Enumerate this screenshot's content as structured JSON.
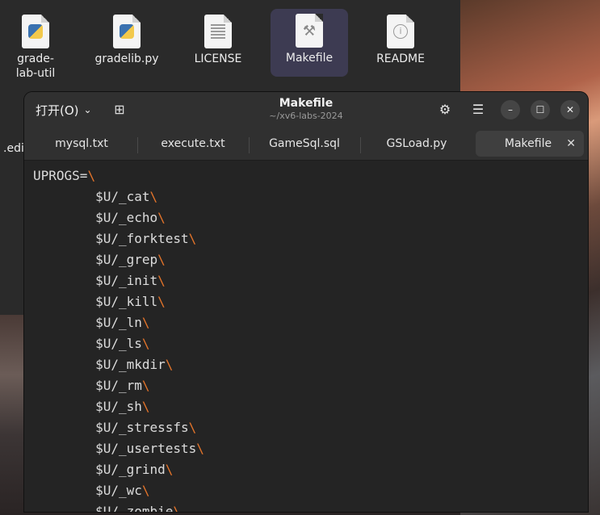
{
  "desktop": {
    "files": [
      {
        "label": "grade-lab-util",
        "icon": "python-file-icon"
      },
      {
        "label": "gradelib.py",
        "icon": "python-file-icon"
      },
      {
        "label": "LICENSE",
        "icon": "text-file-icon"
      },
      {
        "label": "Makefile",
        "icon": "makefile-icon",
        "selected": true
      },
      {
        "label": "README",
        "icon": "info-file-icon"
      }
    ],
    "peek_label": ".edi"
  },
  "window": {
    "open_label": "打开(O)",
    "title": "Makefile",
    "subtitle": "~/xv6-labs-2024",
    "tabs": [
      {
        "label": "mysql.txt"
      },
      {
        "label": "execute.txt"
      },
      {
        "label": "GameSql.sql"
      },
      {
        "label": "GSLoad.py"
      },
      {
        "label": "Makefile",
        "active": true
      }
    ],
    "code_lines": [
      {
        "text": "UPROGS=",
        "cont": "\\"
      },
      {
        "text": "        $U/_cat",
        "cont": "\\"
      },
      {
        "text": "        $U/_echo",
        "cont": "\\"
      },
      {
        "text": "        $U/_forktest",
        "cont": "\\"
      },
      {
        "text": "        $U/_grep",
        "cont": "\\"
      },
      {
        "text": "        $U/_init",
        "cont": "\\"
      },
      {
        "text": "        $U/_kill",
        "cont": "\\"
      },
      {
        "text": "        $U/_ln",
        "cont": "\\"
      },
      {
        "text": "        $U/_ls",
        "cont": "\\"
      },
      {
        "text": "        $U/_mkdir",
        "cont": "\\"
      },
      {
        "text": "        $U/_rm",
        "cont": "\\"
      },
      {
        "text": "        $U/_sh",
        "cont": "\\"
      },
      {
        "text": "        $U/_stressfs",
        "cont": "\\"
      },
      {
        "text": "        $U/_usertests",
        "cont": "\\"
      },
      {
        "text": "        $U/_grind",
        "cont": "\\"
      },
      {
        "text": "        $U/_wc",
        "cont": "\\"
      },
      {
        "text": "        $U/_zombie",
        "cont": "\\"
      }
    ],
    "colors": {
      "continuation": "#e4742a",
      "window_bg": "#242424",
      "header_bg": "#303030"
    }
  }
}
